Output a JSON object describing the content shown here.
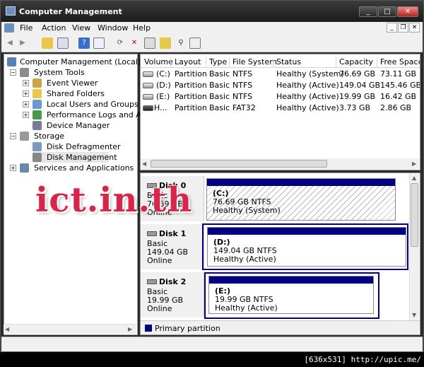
{
  "window": {
    "title": "Computer Management"
  },
  "menu": [
    "File",
    "Action",
    "View",
    "Window",
    "Help"
  ],
  "tree": {
    "root": "Computer Management (Local)",
    "system_tools": "System Tools",
    "event_viewer": "Event Viewer",
    "shared_folders": "Shared Folders",
    "local_users": "Local Users and Groups",
    "perf_logs": "Performance Logs and Alerts",
    "device_manager": "Device Manager",
    "storage": "Storage",
    "disk_defrag": "Disk Defragmenter",
    "disk_mgmt": "Disk Management",
    "services": "Services and Applications"
  },
  "volume_list": {
    "columns": [
      "Volume",
      "Layout",
      "Type",
      "File System",
      "Status",
      "Capacity",
      "Free Space"
    ],
    "rows": [
      {
        "volume": "(C:)",
        "layout": "Partition",
        "type": "Basic",
        "fs": "NTFS",
        "status": "Healthy (System)",
        "capacity": "76.69 GB",
        "free": "73.11 GB"
      },
      {
        "volume": "(D:)",
        "layout": "Partition",
        "type": "Basic",
        "fs": "NTFS",
        "status": "Healthy (Active)",
        "capacity": "149.04 GB",
        "free": "145.46 GB"
      },
      {
        "volume": "(E:)",
        "layout": "Partition",
        "type": "Basic",
        "fs": "NTFS",
        "status": "Healthy (Active)",
        "capacity": "19.99 GB",
        "free": "16.42 GB"
      },
      {
        "volume": "H...",
        "layout": "Partition",
        "type": "Basic",
        "fs": "FAT32",
        "status": "Healthy (Active)",
        "capacity": "3.73 GB",
        "free": "2.86 GB"
      }
    ]
  },
  "disks": [
    {
      "name": "Disk 0",
      "type": "Basic",
      "size": "76.69 GB",
      "state": "Online",
      "part_label": "(C:)",
      "part_size": "76.69 GB NTFS",
      "part_status": "Healthy (System)"
    },
    {
      "name": "Disk 1",
      "type": "Basic",
      "size": "149.04 GB",
      "state": "Online",
      "part_label": "(D:)",
      "part_size": "149.04 GB NTFS",
      "part_status": "Healthy (Active)"
    },
    {
      "name": "Disk 2",
      "type": "Basic",
      "size": "19.99 GB",
      "state": "Online",
      "part_label": "(E:)",
      "part_size": "19.99 GB NTFS",
      "part_status": "Healthy (Active)"
    }
  ],
  "legend": {
    "primary": "Primary partition"
  },
  "watermark": "ict.in.th",
  "footer": "[636x531] http://upic.me/",
  "colors": {
    "primary_partition": "#000080",
    "watermark": "#d7264a"
  }
}
